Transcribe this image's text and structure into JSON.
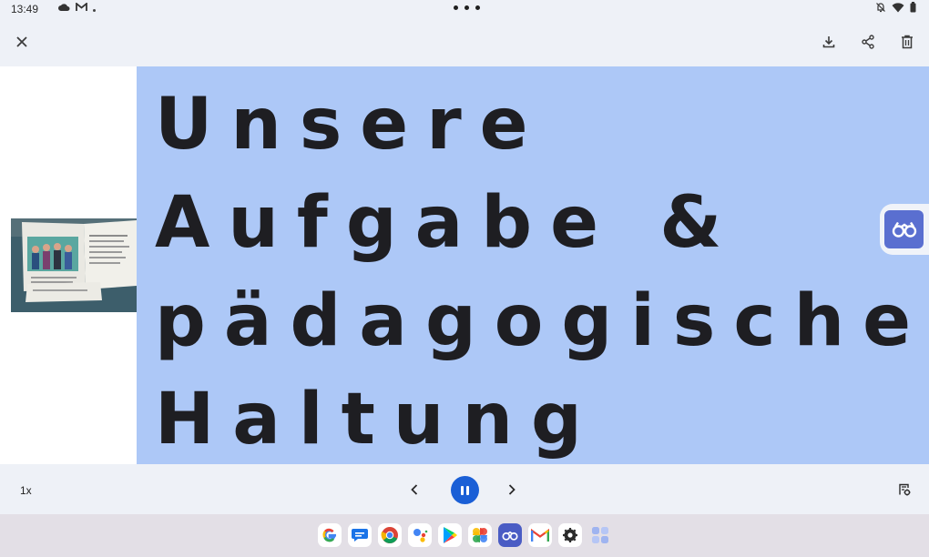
{
  "status_bar": {
    "time": "13:49",
    "left_icons": [
      "cloud-icon",
      "gmail-icon",
      "dot-icon"
    ],
    "right_icons": [
      "mute-bell-icon",
      "wifi-icon",
      "battery-icon"
    ]
  },
  "top_bar": {
    "actions": [
      "close-icon",
      "download-icon",
      "share-icon",
      "delete-icon"
    ]
  },
  "slide": {
    "title": "Unsere\nAufgabe &\npädagogische\nHaltung",
    "background": "#adc8f7"
  },
  "player": {
    "speed": "1x",
    "play_state": "pause-icon",
    "accent": "#1a5fd6"
  },
  "dock": {
    "apps": [
      "google-app-icon",
      "messages-app-icon",
      "chrome-app-icon",
      "assistant-app-icon",
      "play-store-app-icon",
      "photos-app-icon",
      "reader-app-icon",
      "gmail-app-icon",
      "settings-app-icon",
      "app-drawer-icon"
    ]
  }
}
